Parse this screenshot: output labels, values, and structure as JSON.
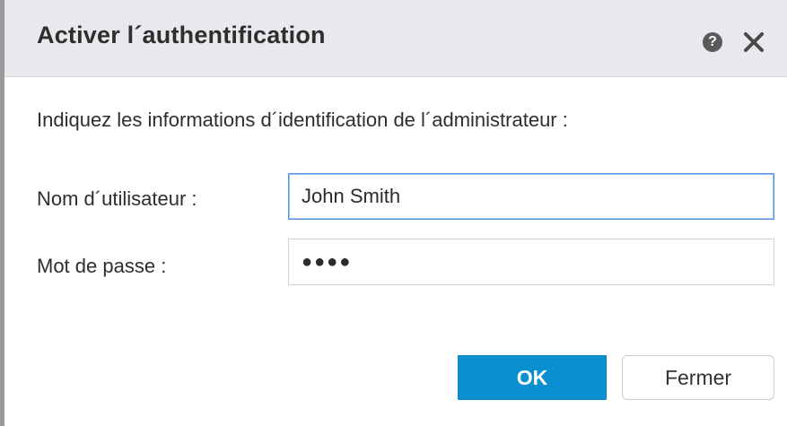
{
  "dialog": {
    "title": "Activer l´authentification",
    "icons": {
      "help": "help-icon",
      "close": "close-icon"
    },
    "help_glyph": "?"
  },
  "form": {
    "instructions": "Indiquez les informations d´identification de l´administrateur :",
    "username_label": "Nom d´utilisateur :",
    "username_value": "John Smith",
    "password_label": "Mot de passe :",
    "password_value": "●●●●"
  },
  "buttons": {
    "ok_label": "OK",
    "close_label": "Fermer"
  },
  "colors": {
    "accent": "#0a90d0",
    "titlebar_bg": "#e8e9ec"
  }
}
